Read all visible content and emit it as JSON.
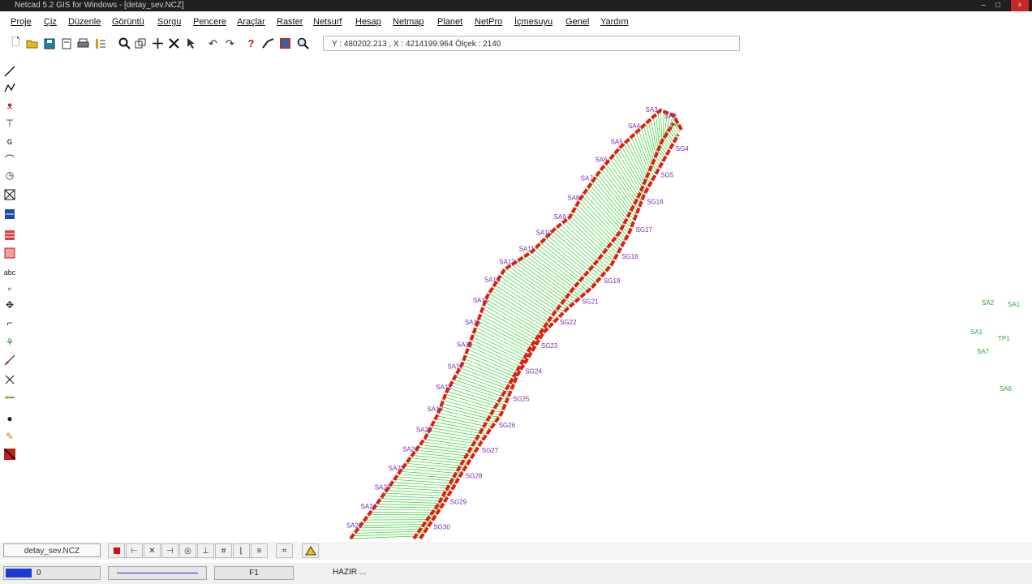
{
  "window": {
    "title": "Netcad 5.2 GIS for Windows - [detay_sev.NCZ]"
  },
  "menu": [
    "Proje",
    "Çiz",
    "Düzenle",
    "Görüntü",
    "Sorgu",
    "Pencere",
    "Araçlar",
    "Raster",
    "Netsurf",
    "Hesap",
    "Netmap",
    "Planet",
    "NetPro",
    "İçmesuyu",
    "Genel",
    "Yardım"
  ],
  "toolbar": {
    "coord_readout": "Y : 480202.213 , X : 4214199.964  Ölçek : 2140",
    "icons": [
      "new-file-icon",
      "open-folder-icon",
      "save-icon",
      "print-preview-icon",
      "print-icon",
      "layers-list-icon",
      "zoom-icon",
      "zoom-window-icon",
      "pan-icon",
      "delete-icon",
      "select-icon",
      "undo-icon",
      "redo-icon",
      "help-icon",
      "line-tool-icon",
      "raster-icon",
      "zoom-extent-icon"
    ]
  },
  "labels": {
    "left_bank": [
      "SA2",
      "SA3",
      "SA4",
      "SA5",
      "SA6",
      "SA7",
      "SA8",
      "SA9",
      "SA10",
      "SA11",
      "SA12",
      "SA13",
      "SA14",
      "SA15",
      "SA16",
      "SA17",
      "SA18",
      "SA19",
      "SA20",
      "SA21",
      "SA22",
      "SA23",
      "SA24",
      "SA25"
    ],
    "right_bank": [
      "SG4",
      "SG5",
      "SG16",
      "SG17",
      "SG18",
      "SG19",
      "SG21",
      "SG22",
      "SG23",
      "SG24",
      "SG25",
      "SG26",
      "SG27",
      "SG28",
      "SG29",
      "SG30"
    ],
    "right_side": [
      "SA2",
      "SA1",
      "SA1",
      "TP1",
      "SA7",
      "SA6"
    ]
  },
  "bottombar": {
    "drawing_tab": "detay_sev.NCZ",
    "buttons": [
      "record-icon",
      "snap-end-icon",
      "snap-intersect-icon",
      "snap-middle-icon",
      "snap-center-icon",
      "snap-perp-icon",
      "grid-icon",
      "ortho-icon",
      "snap-near-icon",
      "snap-all-icon",
      "warning-triangle-icon"
    ]
  },
  "status": {
    "layer_value": "0",
    "function_key": "F1",
    "state": "HAZIR ..."
  },
  "colors": {
    "bank_line": "#e01e12",
    "hatch": "#2fd12a",
    "labels": "#7a2aa8",
    "right_labels": "#2aa840"
  }
}
